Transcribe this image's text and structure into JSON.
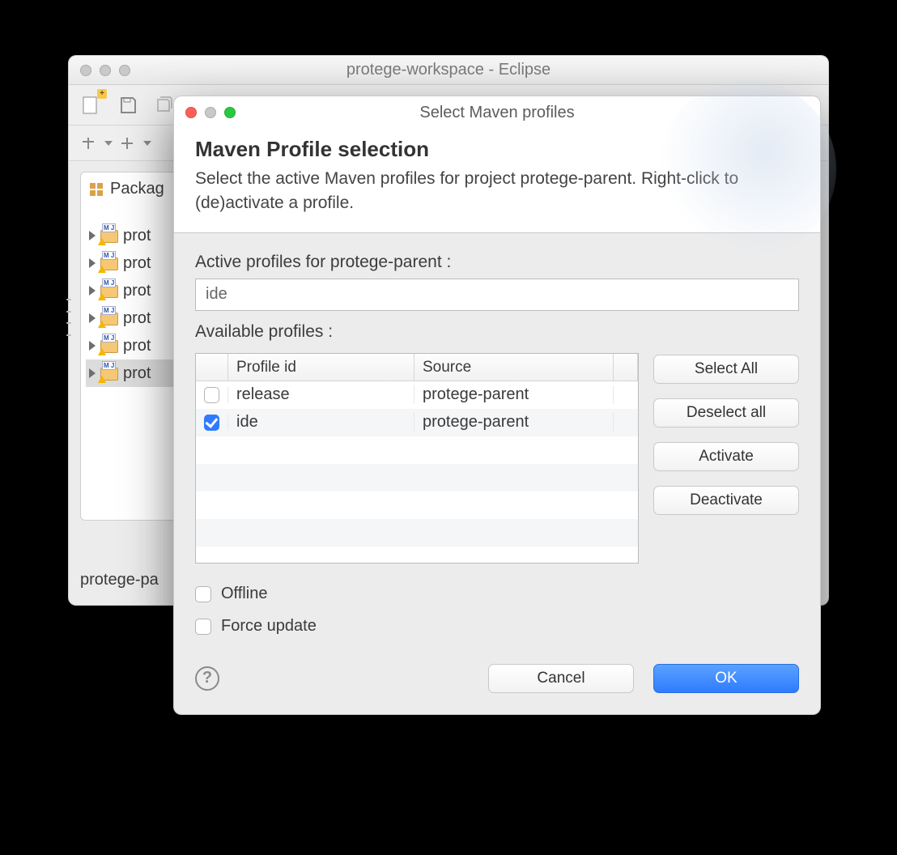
{
  "eclipse": {
    "title": "protege-workspace - Eclipse",
    "package_tab": "Packag",
    "tree_items": [
      "prot",
      "prot",
      "prot",
      "prot",
      "prot",
      "prot"
    ],
    "selected_index": 5,
    "status": "protege-pa"
  },
  "dialog": {
    "title": "Select Maven profiles",
    "heading": "Maven Profile selection",
    "subtitle": "Select the active Maven profiles for project protege-parent. Right-click to (de)activate a profile.",
    "active_label": "Active profiles for protege-parent :",
    "active_value": "ide",
    "available_label": "Available profiles :",
    "columns": {
      "profile_id": "Profile id",
      "source": "Source"
    },
    "rows": [
      {
        "checked": false,
        "id": "release",
        "source": "protege-parent"
      },
      {
        "checked": true,
        "id": "ide",
        "source": "protege-parent"
      }
    ],
    "buttons": {
      "select_all": "Select All",
      "deselect_all": "Deselect all",
      "activate": "Activate",
      "deactivate": "Deactivate",
      "cancel": "Cancel",
      "ok": "OK"
    },
    "offline": {
      "label": "Offline",
      "checked": false
    },
    "force_update": {
      "label": "Force update",
      "checked": false
    }
  }
}
